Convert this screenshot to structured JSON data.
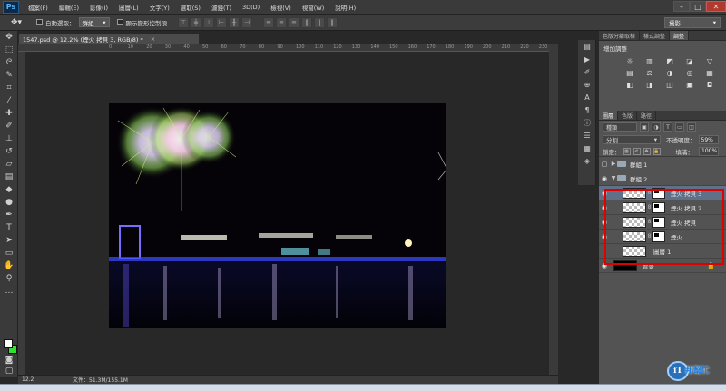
{
  "menubar": {
    "logo": "Ps",
    "items": [
      "檔案(F)",
      "編輯(E)",
      "影像(I)",
      "圖層(L)",
      "文字(Y)",
      "選取(S)",
      "濾鏡(T)",
      "3D(D)",
      "檢視(V)",
      "視窗(W)",
      "說明(H)"
    ],
    "minimize": "–",
    "restore": "□",
    "close": "✕"
  },
  "optionsbar": {
    "auto_select_label": "自動選取：",
    "auto_select_target": "群組",
    "show_transform_label": "顯示變形控制項",
    "workspace": "攝影"
  },
  "document": {
    "tab_title": "1547.psd @ 12.2% (煙火 拷貝 3, RGB/8) *",
    "close": "×",
    "ruler_ticks": [
      "0",
      "10",
      "20",
      "30",
      "40",
      "50",
      "60",
      "70",
      "80",
      "90",
      "100",
      "110",
      "120",
      "130",
      "140",
      "150",
      "160",
      "170",
      "180",
      "190",
      "200",
      "210",
      "220",
      "230"
    ],
    "status_zoom": "12.2",
    "status_doc": "文件：51.3M/155.1M"
  },
  "adjust_panel": {
    "tabs": [
      "色版分離取樣",
      "樣式調整",
      "調整"
    ],
    "active_tab": 2,
    "title": "增加調整",
    "icons_row1": [
      "☼",
      "▥",
      "◩",
      "◪",
      "▽"
    ],
    "icons_row2": [
      "▤",
      "⚖",
      "◑",
      "◎",
      "▦"
    ],
    "icons_row3": [
      "◧",
      "◨",
      "◫",
      "▣",
      "◘"
    ]
  },
  "layers_panel": {
    "tabs": [
      "圖層",
      "色版",
      "路徑"
    ],
    "active_tab": 0,
    "kind": "種類",
    "blend_mode": "分割",
    "opacity_label": "不透明度：",
    "opacity": "59%",
    "lock_label": "鎖定：",
    "fill_label": "填滿：",
    "fill": "100%",
    "layers": [
      {
        "name": "群組 1",
        "type": "group",
        "expanded": false
      },
      {
        "name": "群組 2",
        "type": "group",
        "expanded": true
      },
      {
        "name": "煙火 拷貝 3",
        "type": "masked",
        "selected": true
      },
      {
        "name": "煙火 拷貝 2",
        "type": "masked"
      },
      {
        "name": "煙火 拷貝",
        "type": "masked"
      },
      {
        "name": "煙火",
        "type": "masked"
      },
      {
        "name": "圖層 1",
        "type": "layer"
      },
      {
        "name": "背景",
        "type": "background"
      }
    ]
  },
  "watermark": {
    "logo": "iT",
    "text": "邦幫忙"
  },
  "colors": {
    "foreground": "#ffffff",
    "background": "#2fe02f",
    "highlight": "#e00000"
  }
}
